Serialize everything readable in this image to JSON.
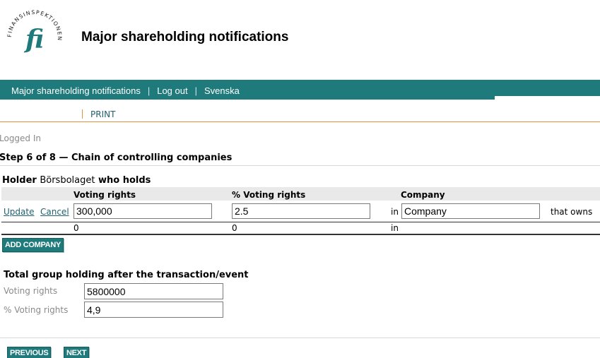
{
  "header": {
    "logo_text": "FINANSINSPEKTIONEN",
    "logo_monogram": "fi",
    "title": "Major shareholding notifications"
  },
  "nav": {
    "items": [
      "Major shareholding notifications",
      "Log out",
      "Svenska"
    ],
    "separator": "|"
  },
  "print_label": "PRINT",
  "status": "Logged In",
  "step_title": "Step 6 of 8 — Chain of controlling companies",
  "holder": {
    "prefix": "Holder",
    "name": "Börsbolaget",
    "suffix": "who holds"
  },
  "table": {
    "headers": [
      "Voting rights",
      "% Voting rights",
      "Company"
    ],
    "edit_row": {
      "update_label": "Update",
      "cancel_label": "Cancel",
      "voting_rights": "300,000",
      "pct_voting_rights": "2.5",
      "in_label": "in",
      "company": "Company",
      "trailing": "that owns"
    },
    "summary_row": {
      "voting_rights": "0",
      "pct_voting_rights": "0",
      "in_label": "in"
    }
  },
  "add_company_label": "ADD COMPANY",
  "total": {
    "title": "Total group holding after the transaction/event",
    "voting_rights_label": "Voting rights",
    "voting_rights_value": "5800000",
    "pct_label": "% Voting rights",
    "pct_value": "4,9"
  },
  "buttons": {
    "previous": "PREVIOUS",
    "next": "NEXT"
  },
  "colors": {
    "brand": "#1f7a7c",
    "link": "#1f5f6e",
    "accent": "#e0913a"
  }
}
